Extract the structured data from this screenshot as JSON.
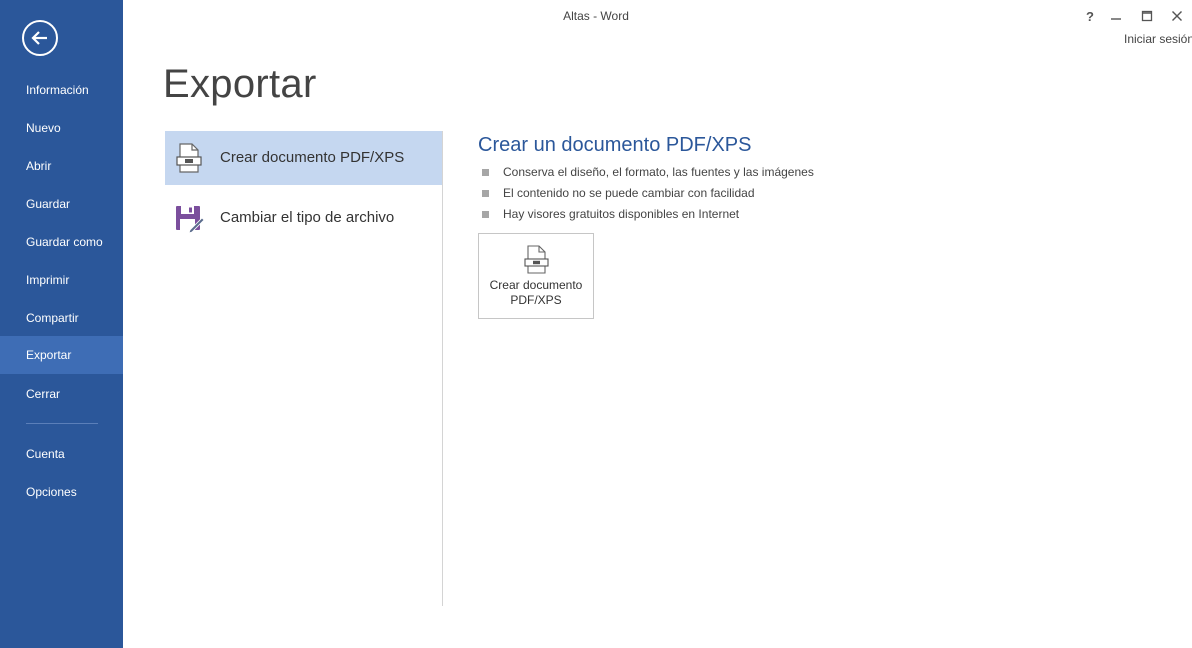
{
  "window": {
    "title": "Altas - Word",
    "help": "?",
    "sign_in": "Iniciar sesión"
  },
  "sidebar": {
    "back_icon": "back-arrow-icon",
    "items": [
      {
        "label": "Información",
        "active": false
      },
      {
        "label": "Nuevo",
        "active": false
      },
      {
        "label": "Abrir",
        "active": false
      },
      {
        "label": "Guardar",
        "active": false
      },
      {
        "label": "Guardar como",
        "active": false
      },
      {
        "label": "Imprimir",
        "active": false
      },
      {
        "label": "Compartir",
        "active": false
      },
      {
        "label": "Exportar",
        "active": true
      },
      {
        "label": "Cerrar",
        "active": false
      },
      {
        "label": "Cuenta",
        "active": false
      },
      {
        "label": "Opciones",
        "active": false
      }
    ]
  },
  "page": {
    "title": "Exportar"
  },
  "options": [
    {
      "label": "Crear documento PDF/XPS",
      "icon": "pdf-document-icon",
      "selected": true
    },
    {
      "label": "Cambiar el tipo de archivo",
      "icon": "save-as-file-type-icon",
      "selected": false
    }
  ],
  "detail": {
    "title": "Crear un documento PDF/XPS",
    "bullets": [
      "Conserva el diseño, el formato, las fuentes y las imágenes",
      "El contenido no se puede cambiar con facilidad",
      "Hay visores gratuitos disponibles en Internet"
    ],
    "button": {
      "line1": "Crear documento",
      "line2": "PDF/XPS",
      "icon": "pdf-document-icon"
    }
  },
  "colors": {
    "sidebar": "#2b579a",
    "sidebar_active": "#3e6db5",
    "selected_option": "#c5d7f0",
    "accent_text": "#2b579a",
    "purple_icon": "#7b4f9d"
  }
}
